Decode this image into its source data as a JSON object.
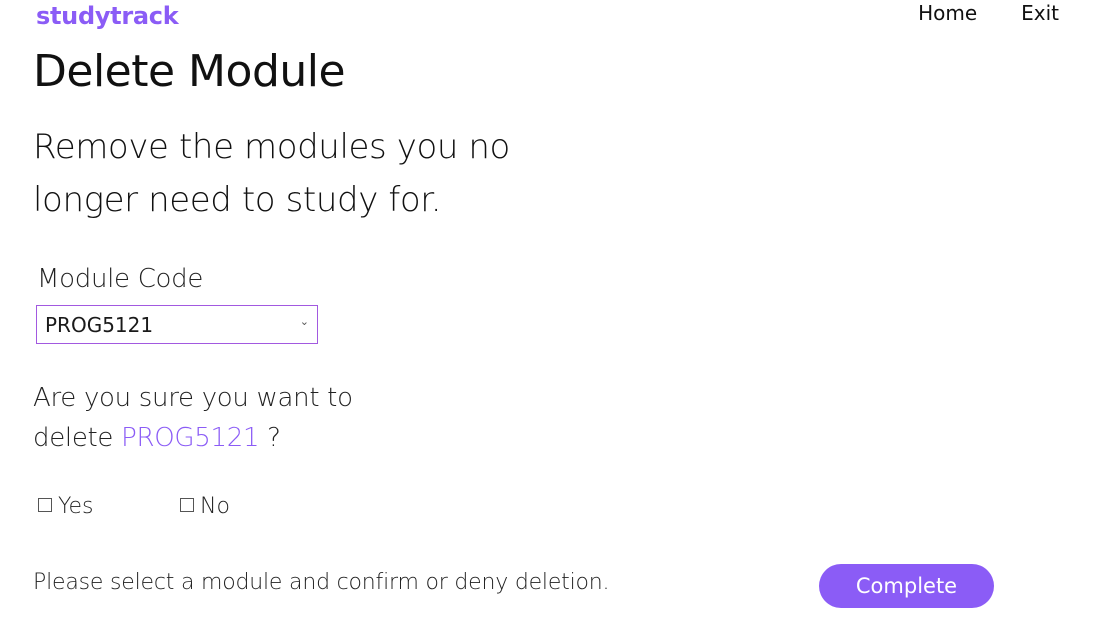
{
  "header": {
    "brand": "studytrack",
    "nav": {
      "home_label": "Home",
      "exit_label": "Exit"
    }
  },
  "main": {
    "title": "Delete Module",
    "subtitle": "Remove the modules you no longer need to study for.",
    "module_field": {
      "label": "Module Code",
      "selected_value": "PROG5121",
      "chevron_icon": "chevron-down-icon"
    },
    "confirm": {
      "prefix": "Are you sure you want to delete ",
      "module": "PROG5121",
      "suffix": " ?"
    },
    "options": {
      "yes_label": "Yes",
      "no_label": "No",
      "yes_checked": false,
      "no_checked": false
    },
    "status_text": "Please select a module and confirm or deny deletion.",
    "complete_label": "Complete"
  },
  "colors": {
    "accent": "#8b5cf6",
    "select_border": "#a259e0",
    "button_text": "#ffffff",
    "text": "#1a1a1a"
  }
}
